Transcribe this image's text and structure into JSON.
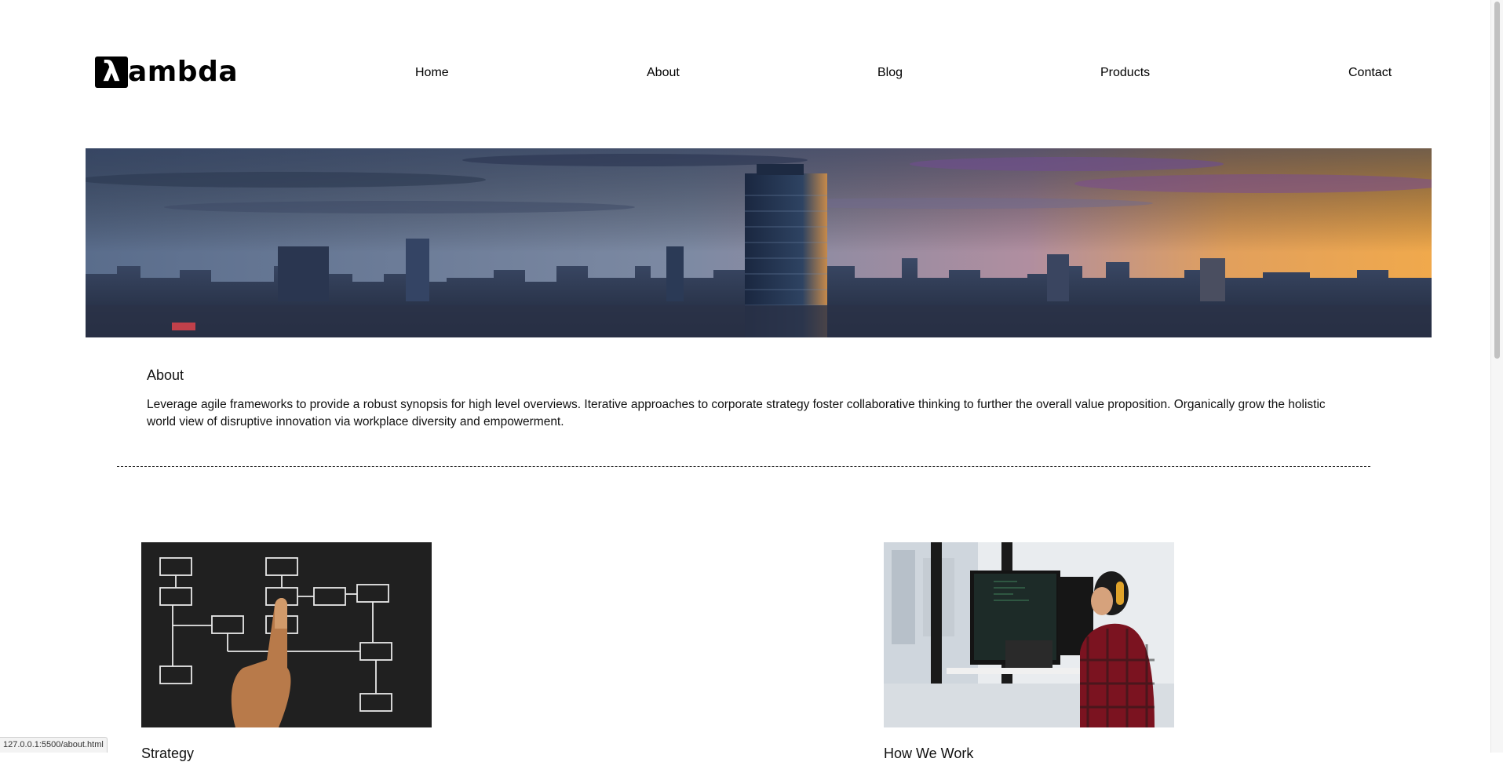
{
  "brand": {
    "logo_mark": "λ",
    "logo_word": "ambda"
  },
  "nav": {
    "items": [
      {
        "label": "Home"
      },
      {
        "label": "About"
      },
      {
        "label": "Blog"
      },
      {
        "label": "Products"
      },
      {
        "label": "Contact"
      }
    ]
  },
  "hero": {
    "image": "city-skyline-at-sunset"
  },
  "about": {
    "title": "About",
    "text": "Leverage agile frameworks to provide a robust synopsis for high level overviews. Iterative approaches to corporate strategy foster collaborative thinking to further the overall value proposition. Organically grow the holistic world view of disruptive innovation via workplace diversity and empowerment."
  },
  "cards": [
    {
      "image": "flowchart-chalkboard-with-finger",
      "title": "Strategy"
    },
    {
      "image": "developer-with-headphones-at-monitors",
      "title": "How We Work"
    }
  ],
  "status_url": "127.0.0.1:5500/about.html",
  "colors": {
    "background": "#ffffff",
    "text": "#111111",
    "logo_box": "#000000"
  }
}
